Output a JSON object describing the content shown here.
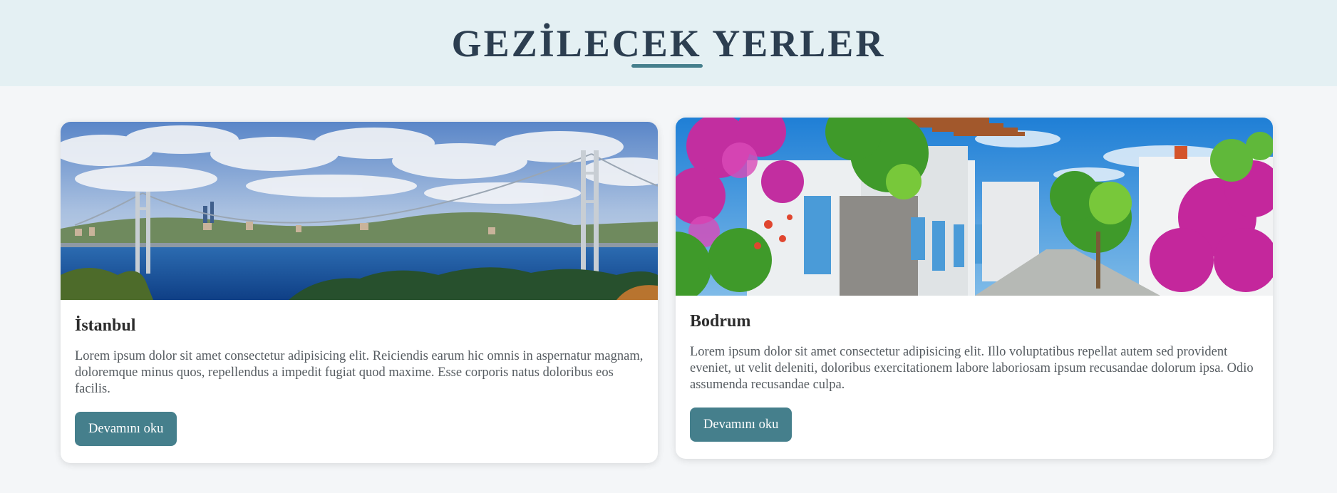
{
  "header": {
    "title": "GEZİLECEK YERLER"
  },
  "cards": [
    {
      "title": "İstanbul",
      "text": "Lorem ipsum dolor sit amet consectetur adipisicing elit. Reiciendis earum hic omnis in aspernatur magnam, doloremque minus quos, repellendus a impedit fugiat quod maxime. Esse corporis natus doloribus eos facilis.",
      "button_label": "Devamını oku"
    },
    {
      "title": "Bodrum",
      "text": "Lorem ipsum dolor sit amet consectetur adipisicing elit. Illo voluptatibus repellat autem sed provident eveniet, ut velit deleniti, doloribus exercitationem labore laboriosam ipsum recusandae dolorum ipsa. Odio assumenda recusandae culpa.",
      "button_label": "Devamını oku"
    }
  ],
  "colors": {
    "header_bg": "#e4f0f3",
    "title_color": "#2c3e50",
    "accent": "#457f8c",
    "page_bg": "#f4f6f8"
  }
}
